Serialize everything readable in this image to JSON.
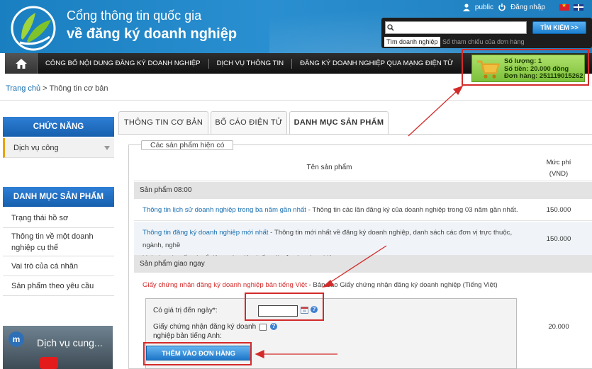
{
  "header": {
    "title_line1": "Cổng thông tin quốc gia",
    "title_line2": "về đăng ký doanh nghiệp",
    "user_name": "public",
    "login_label": "Đăng nhập"
  },
  "search": {
    "placeholder": "",
    "button_label": "TÌM KIẾM >>",
    "tab_active": "Tìm doanh nghiệp",
    "tab_other": "Số tham chiếu của đơn hàng"
  },
  "nav": {
    "items": [
      "CÔNG BỐ NỘI DUNG ĐĂNG KÝ DOANH NGHIỆP",
      "DỊCH VỤ THÔNG TIN",
      "ĐĂNG KÝ DOANH NGHIỆP QUA MẠNG ĐIỆN TỬ"
    ]
  },
  "cart": {
    "quantity": "Số lượng: 1",
    "amount": "Số tiền: 20.000 đồng",
    "order": "Đơn hàng: 251119015262"
  },
  "breadcrumb": {
    "home": "Trang chủ",
    "separator": " > ",
    "current": "Thông tin cơ bản"
  },
  "sidebar": {
    "functions_title": "CHỨC NĂNG",
    "public_service": "Dịch vụ công",
    "products_title": "DANH MỤC SẢN PHẨM",
    "items": [
      "Trạng thái hồ sơ",
      "Thông tin về một doanh nghiệp cụ thể",
      "Vai trò của cá nhân",
      "Sản phẩm theo yêu cầu"
    ],
    "video_logo": "m",
    "video_title": "Dịch vụ cung..."
  },
  "tabs": [
    "THÔNG TIN CƠ BẢN",
    "BỐ CÁO ĐIỆN TỬ",
    "DANH MỤC SẢN PHẨM"
  ],
  "products": {
    "legend": "Các sản phẩm hiện có",
    "col_name": "Tên sản phẩm",
    "col_fee_line1": "Mức phí",
    "col_fee_line2": "(VND)",
    "group1": "Sản phẩm 08:00",
    "row1_link": "Thông tin lịch sử doanh nghiệp trong ba năm gần nhất",
    "row1_desc": " - Thông tin các lần đăng ký của doanh nghiệp trong 03 năm gần nhất.",
    "row1_fee": "150.000",
    "row2_link": "Thông tin đăng ký doanh nghiệp mới nhất",
    "row2_desc": " - Thông tin mới nhất về đăng ký doanh nghiệp, danh sách các đơn vị trực thuộc, ngành, nghề",
    "row2_desc2": "kinh doanh, vốn và cổ đông sáng lập (nếu có) của doanh nghiệp.",
    "row2_fee": "150.000",
    "group2": "Sản phẩm giao ngay",
    "row3_link": "Giấy chứng nhận đăng ký doanh nghiệp bản tiếng Việt",
    "row3_desc": " - Bản sao Giấy chứng nhận đăng ký doanh nghiệp (Tiếng Việt)",
    "row3_fee": "20.000",
    "valid_until_label": "Có giá trị đến ngày*:",
    "english_cert_label1": "Giấy chứng nhận đăng ký doanh",
    "english_cert_label2": "nghiệp bản tiếng Anh:",
    "help": "?",
    "add_button": "THÊM VÀO ĐƠN HÀNG"
  },
  "colors": {
    "header_blue": "#1a7fc0",
    "nav_dark": "#1d1d1d",
    "cart_green": "#8fcc48",
    "annotation_red": "#d42a2a",
    "sidebar_blue": "#1e6fc4"
  }
}
